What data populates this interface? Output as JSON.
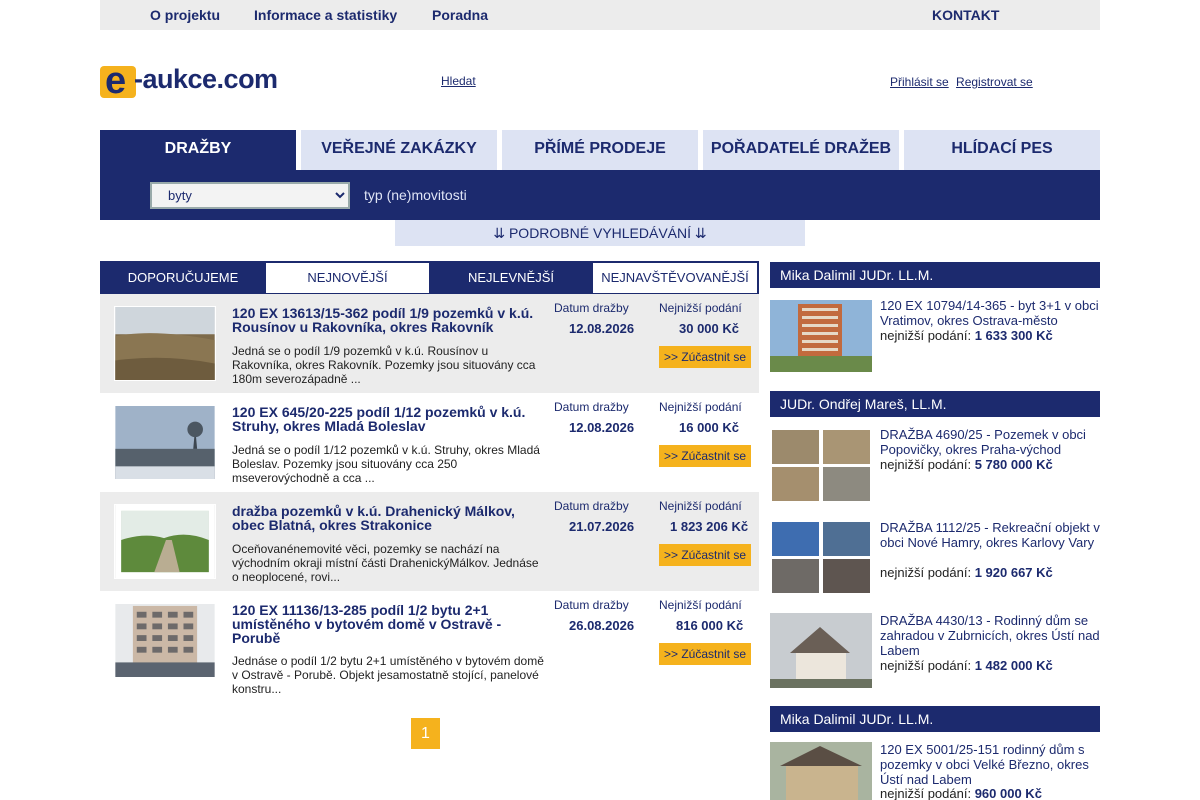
{
  "topnav": {
    "about": "O projektu",
    "info": "Informace a statistiky",
    "advice": "Poradna",
    "contact": "KONTAKT"
  },
  "header": {
    "logo_e": "e",
    "logo_rest": "-aukce.com",
    "search_link": "Hledat",
    "login": "Přihlásit se",
    "register": "Registrovat se"
  },
  "maintabs": [
    "DRAŽBY",
    "VEŘEJNÉ ZAKÁZKY",
    "PŘÍMÉ PRODEJE",
    "POŘADATELÉ DRAŽEB",
    "HLÍDACÍ PES"
  ],
  "filter": {
    "selected": "byty",
    "label": "typ (ne)movitosti"
  },
  "advanced_search": "⇊ PODROBNÉ VYHLEDÁVÁNÍ ⇊",
  "listtabs": [
    "DOPORUČUJEME",
    "NEJNOVĚJŠÍ",
    "NEJLEVNĚJŠÍ",
    "NEJNAVŠTĚVOVANĚJŠÍ"
  ],
  "listings": [
    {
      "title": "120 EX 13613/15-362 podíl 1/9 pozemků v k.ú. Rousínov u Rakovníka, okres Rakovník",
      "desc": "Jedná se o podíl 1/9 pozemků v k.ú. Rousínov u Rakovníka, okres Rakovník. Pozemky jsou situovány cca 180m severozápadně ...",
      "date_label": "Datum dražby",
      "date": "12.08.2026",
      "price_label": "Nejnižší podání",
      "price": "30 000 Kč",
      "button": ">> Zúčastnit se"
    },
    {
      "title": "120 EX 645/20-225 podíl 1/12 pozemků v k.ú. Struhy, okres Mladá Boleslav",
      "desc": "Jedná se o podíl 1/12 pozemků v k.ú. Struhy, okres Mladá Boleslav. Pozemky jsou situovány cca 250 mseverovýchodně a cca ...",
      "date_label": "Datum dražby",
      "date": "12.08.2026",
      "price_label": "Nejnižší podání",
      "price": "16 000 Kč",
      "button": ">> Zúčastnit se"
    },
    {
      "title": "dražba pozemků v k.ú. Drahenický Málkov, obec Blatná, okres Strakonice",
      "desc": "Oceňovanénemovité věci, pozemky se nachází na východním okraji místní části DrahenickýMálkov. Jednáse o neoplocené, rovi...",
      "date_label": "Datum dražby",
      "date": "21.07.2026",
      "price_label": "Nejnižší podání",
      "price": "1 823 206 Kč",
      "button": ">> Zúčastnit se"
    },
    {
      "title": "120 EX 11136/13-285 podíl 1/2 bytu 2+1 umístěného v bytovém domě v Ostravě - Porubě",
      "desc": "Jednáse o podíl 1/2 bytu 2+1 umístěného v bytovém domě v Ostravě - Porubě. Objekt jesamostatně stojící, panelové konstru...",
      "date_label": "Datum dražby",
      "date": "26.08.2026",
      "price_label": "Nejnižší podání",
      "price": "816 000 Kč",
      "button": ">> Zúčastnit se"
    }
  ],
  "pager": {
    "current": "1"
  },
  "sidebar": {
    "groups": [
      {
        "auctioneer": "Mika Dalimil JUDr. LL.M.",
        "items": [
          {
            "text": "120 EX 10794/14-365 - byt 3+1 v obci Vratimov, okres Ostrava-město",
            "price_label": "nejnižší podání:",
            "price": "1 633 300 Kč"
          }
        ]
      },
      {
        "auctioneer": "JUDr. Ondřej Mareš, LL.M.",
        "items": [
          {
            "text": "DRAŽBA 4690/25 - Pozemek v obci Popovičky, okres Praha-východ",
            "price_label": "nejnižší podání:",
            "price": "5 780 000 Kč"
          },
          {
            "text": "DRAŽBA 1112/25 - Rekreační objekt v obci Nové Hamry, okres Karlovy Vary",
            "price_label": "nejnižší podání:",
            "price": "1 920 667 Kč"
          },
          {
            "text": "DRAŽBA 4430/13 - Rodinný dům se zahradou v Zubrnicích, okres Ústí nad Labem",
            "price_label": "nejnižší podání:",
            "price": "1 482 000 Kč"
          }
        ]
      },
      {
        "auctioneer": "Mika Dalimil JUDr. LL.M.",
        "items": [
          {
            "text": "120 EX 5001/25-151 rodinný dům s pozemky v obci Velké Březno, okres Ústí nad Labem",
            "price_label": "nejnižší podání:",
            "price": "960 000 Kč"
          }
        ]
      }
    ]
  },
  "colors": {
    "brand_navy": "#1c2a6e",
    "accent_yellow": "#f5b21d",
    "tab_light": "#dde3f3"
  }
}
